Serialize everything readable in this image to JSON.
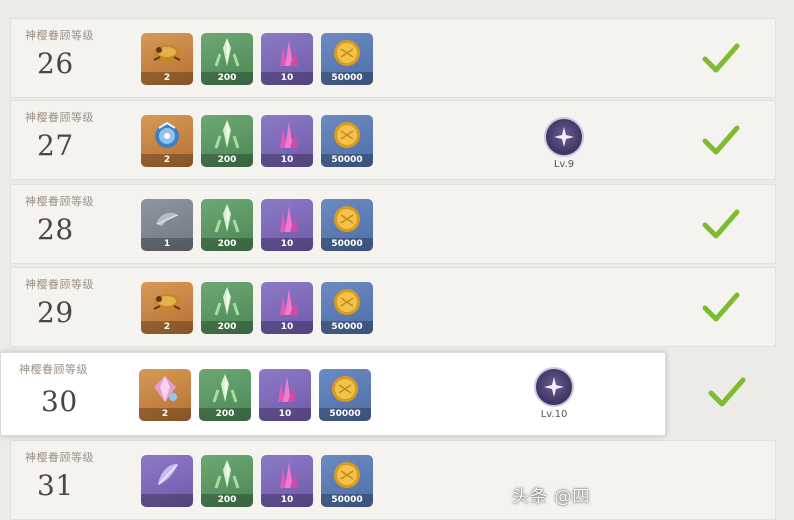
{
  "rows": [
    {
      "label": "神樱眷顾等级",
      "level": "26",
      "items": [
        {
          "icon": "golden-beetle-icon",
          "rarity": 5,
          "qty": "2"
        },
        {
          "icon": "green-shard-icon",
          "rarity": 2,
          "qty": "200"
        },
        {
          "icon": "purple-crystal-icon",
          "rarity": 4,
          "qty": "10"
        },
        {
          "icon": "mora-coin-icon",
          "rarity": 3,
          "qty": "50000"
        }
      ],
      "talent": null,
      "claimed": true
    },
    {
      "label": "神樱眷顾等级",
      "level": "27",
      "items": [
        {
          "icon": "blue-crown-icon",
          "rarity": 5,
          "qty": "2"
        },
        {
          "icon": "green-shard-icon",
          "rarity": 2,
          "qty": "200"
        },
        {
          "icon": "purple-crystal-icon",
          "rarity": 4,
          "qty": "10"
        },
        {
          "icon": "mora-coin-icon",
          "rarity": 3,
          "qty": "50000"
        }
      ],
      "talent": {
        "level": "Lv.9",
        "icon": "wind-talent-icon"
      },
      "claimed": true
    },
    {
      "label": "神樱眷顾等级",
      "level": "28",
      "items": [
        {
          "icon": "gray-feather-icon",
          "rarity": 1,
          "qty": "1"
        },
        {
          "icon": "green-shard-icon",
          "rarity": 2,
          "qty": "200"
        },
        {
          "icon": "purple-crystal-icon",
          "rarity": 4,
          "qty": "10"
        },
        {
          "icon": "mora-coin-icon",
          "rarity": 3,
          "qty": "50000"
        }
      ],
      "talent": null,
      "claimed": true
    },
    {
      "label": "神樱眷顾等级",
      "level": "29",
      "items": [
        {
          "icon": "golden-beetle-icon",
          "rarity": 5,
          "qty": "2"
        },
        {
          "icon": "green-shard-icon",
          "rarity": 2,
          "qty": "200"
        },
        {
          "icon": "purple-crystal-icon",
          "rarity": 4,
          "qty": "10"
        },
        {
          "icon": "mora-coin-icon",
          "rarity": 3,
          "qty": "50000"
        }
      ],
      "talent": null,
      "claimed": true
    },
    {
      "label": "神樱眷顾等级",
      "level": "30",
      "items": [
        {
          "icon": "pink-crystal-icon",
          "rarity": 5,
          "qty": "2"
        },
        {
          "icon": "green-shard-icon",
          "rarity": 2,
          "qty": "200"
        },
        {
          "icon": "purple-crystal-icon",
          "rarity": 4,
          "qty": "10"
        },
        {
          "icon": "mora-coin-icon",
          "rarity": 3,
          "qty": "50000"
        }
      ],
      "talent": {
        "level": "Lv.10",
        "icon": "wind-talent-icon"
      },
      "claimed": true,
      "highlight": true
    },
    {
      "label": "神樱眷顾等级",
      "level": "31",
      "items": [
        {
          "icon": "purple-feather-icon",
          "rarity": 4,
          "qty": ""
        },
        {
          "icon": "green-shard-icon",
          "rarity": 2,
          "qty": "200"
        },
        {
          "icon": "purple-crystal-icon",
          "rarity": 4,
          "qty": "10"
        },
        {
          "icon": "mora-coin-icon",
          "rarity": 3,
          "qty": "50000"
        }
      ],
      "talent": null,
      "claimed": false
    }
  ],
  "watermark": "头条 @四",
  "colors": {
    "check": "#7cbc2e",
    "row_bg": "#f4f3f0",
    "highlight_bg": "#ffffff",
    "level_text": "#4a4642",
    "label_text": "#9c8f83"
  }
}
